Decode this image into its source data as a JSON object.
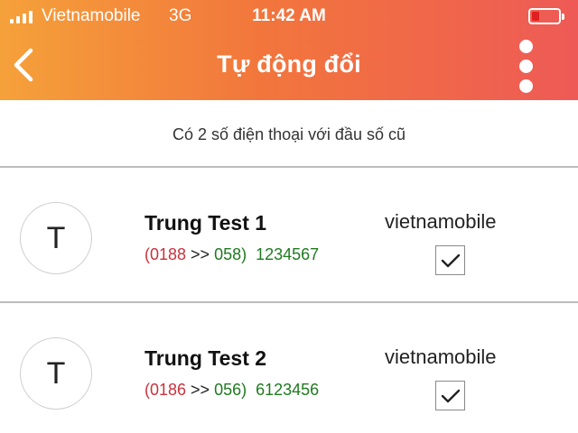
{
  "status_bar": {
    "carrier": "Vietnamobile",
    "network": "3G",
    "time": "11:42 AM",
    "battery_level": 0.3,
    "battery_color": "#e02020"
  },
  "nav": {
    "back_icon": "chevron-left-icon",
    "title": "Tự động đổi",
    "more_icon": "more-vertical-icon"
  },
  "subtitle": "Có 2 số điện thoại với đầu số cũ",
  "colors": {
    "header_start": "#f5a13a",
    "header_end": "#ee5a56",
    "old_prefix": "#c8323c",
    "new_prefix": "#1f7a1f"
  },
  "contacts": [
    {
      "initial": "T",
      "name": "Trung Test 1",
      "old_prefix": "(0188",
      "arrow": " >> ",
      "new_prefix": "058)",
      "subscriber": "  1234567",
      "provider": "vietnamobile",
      "checked": true
    },
    {
      "initial": "T",
      "name": "Trung Test 2",
      "old_prefix": "(0186",
      "arrow": " >> ",
      "new_prefix": "056)",
      "subscriber": "  6123456",
      "provider": "vietnamobile",
      "checked": true
    }
  ]
}
